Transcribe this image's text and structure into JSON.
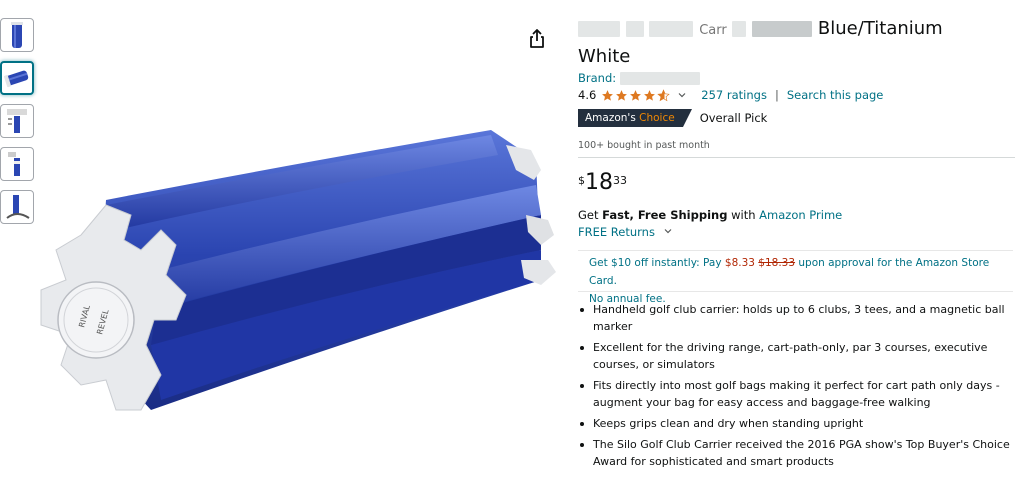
{
  "thumbnails": [
    {
      "name": "thumb-1",
      "active": false
    },
    {
      "name": "thumb-2",
      "active": true
    },
    {
      "name": "thumb-3",
      "active": false
    },
    {
      "name": "thumb-4",
      "active": false
    },
    {
      "name": "thumb-5",
      "active": false
    }
  ],
  "icons": {
    "share": "share-icon",
    "chevron": "chevron-down-icon",
    "star": "star-icon"
  },
  "hero": {
    "logo_top": "RIVAL",
    "logo_bottom": "REVEL"
  },
  "product": {
    "title_visible_end": "Blue/Titanium",
    "title_line2": "White",
    "title_fragment": "Carr",
    "brand_label": "Brand:",
    "rating_value": "4.6",
    "ratings_link": "257 ratings",
    "separator": "|",
    "search_link": "Search this page",
    "badge_prefix": "Amazon's",
    "badge_choice": "Choice",
    "badge_suffix": "Overall Pick",
    "bought": "100+ bought in past month",
    "price_symbol": "$",
    "price_whole": "18",
    "price_fraction": "33",
    "shipping_get": "Get",
    "shipping_bold": "Fast, Free Shipping",
    "shipping_with": "with",
    "shipping_prime": "Amazon Prime",
    "free_returns": "FREE Returns",
    "promo_1": "Get $10 off instantly: Pay",
    "promo_new": "$8.33",
    "promo_old": "$18.33",
    "promo_2": "upon approval for the Amazon Store Card.",
    "promo_3": "No annual fee."
  },
  "colors": {
    "link": "#007185",
    "badge_bg": "#232f3e",
    "choice": "#f08804",
    "star": "#de7921",
    "price_red": "#b12704",
    "product_blue": "#2b46b3"
  },
  "bullets": [
    "Handheld golf club carrier: holds up to 6 clubs, 3 tees, and a magnetic ball marker",
    "Excellent for the driving range, cart-path-only, par 3 courses, executive courses, or simulators",
    "Fits directly into most golf bags making it perfect for cart path only days - augment your bag for easy access and baggage-free walking",
    "Keeps grips clean and dry when standing upright",
    "The Silo Golf Club Carrier received the 2016 PGA show's Top Buyer's Choice Award for sophisticated and smart products"
  ]
}
